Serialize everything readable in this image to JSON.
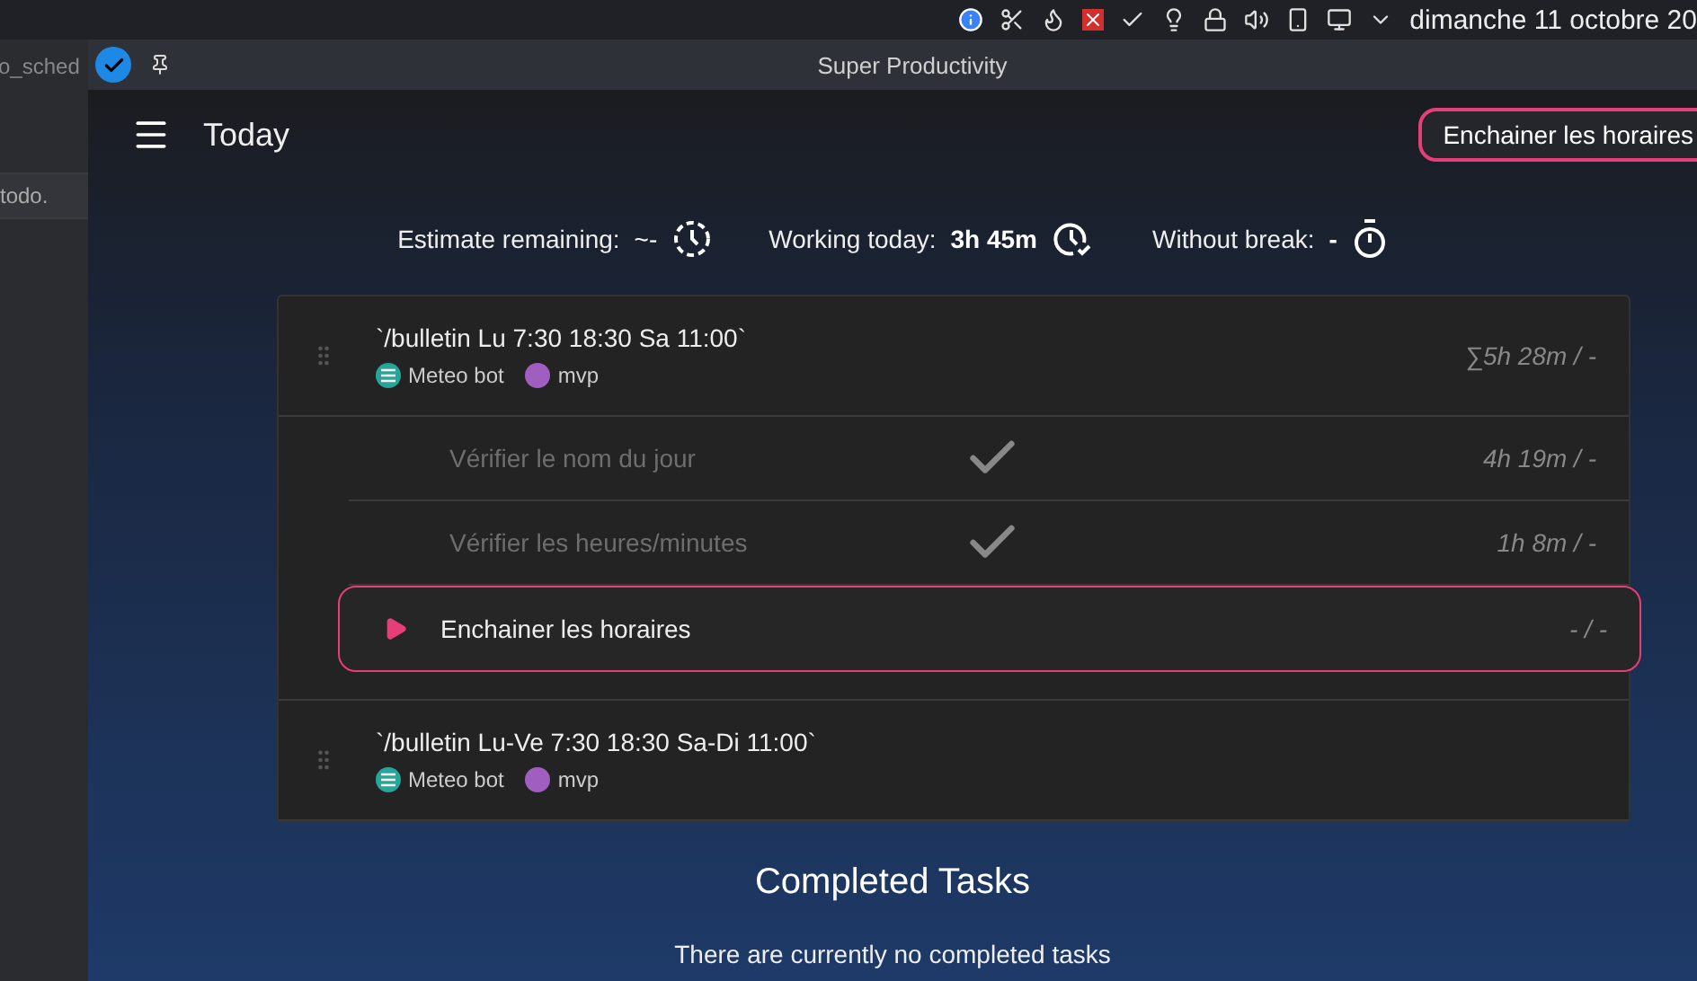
{
  "system_bar": {
    "date": "dimanche 11 octobre 20"
  },
  "background_window": {
    "tab": "o_sched",
    "file": "todo."
  },
  "window": {
    "title": "Super Productivity"
  },
  "header": {
    "title": "Today",
    "button": "Enchainer les horaires"
  },
  "stats": [
    {
      "label": "Estimate remaining:",
      "value": "~-",
      "bold": false,
      "kind": "dashed-clock"
    },
    {
      "label": "Working today:",
      "value": "3h 45m",
      "bold": true,
      "kind": "check-clock"
    },
    {
      "label": "Without break:",
      "value": "-",
      "bold": true,
      "kind": "stopwatch"
    }
  ],
  "tasks": [
    {
      "title": "`/bulletin Lu 7:30 18:30 Sa 11:00`",
      "time": "∑5h 28m / -",
      "tags": [
        {
          "name": "Meteo bot",
          "kind": "project",
          "color": "#26a69a"
        },
        {
          "name": "mvp",
          "kind": "tag",
          "color": "#a05ec0"
        }
      ],
      "subtasks": [
        {
          "title": "Vérifier le nom du jour",
          "time": "4h 19m / -",
          "done": true,
          "current": false
        },
        {
          "title": "Vérifier les heures/minutes",
          "time": "1h 8m / -",
          "done": true,
          "current": false
        },
        {
          "title": "Enchainer les horaires",
          "time": "- / -",
          "done": false,
          "current": true
        }
      ]
    },
    {
      "title": "`/bulletin Lu-Ve 7:30 18:30 Sa-Di 11:00`",
      "tags": [
        {
          "name": "Meteo bot",
          "kind": "project",
          "color": "#26a69a"
        },
        {
          "name": "mvp",
          "kind": "tag",
          "color": "#a05ec0"
        }
      ]
    }
  ],
  "completed": {
    "title": "Completed Tasks",
    "empty": "There are currently no completed tasks"
  }
}
